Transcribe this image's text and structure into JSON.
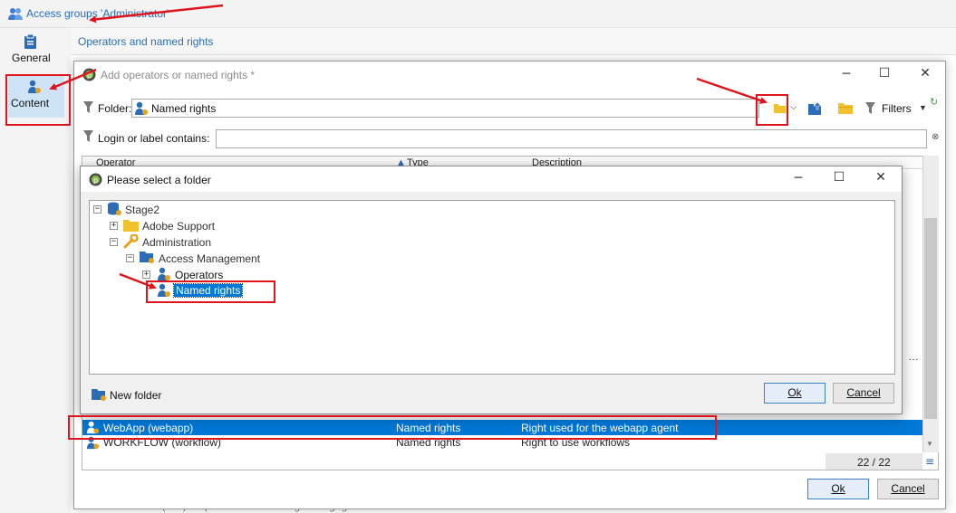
{
  "header": {
    "title": "Access groups 'Administrator'"
  },
  "left_rail": {
    "general_label": "General",
    "content_label": "Content"
  },
  "sub_header": {
    "title": "Operators and named rights"
  },
  "background_row_text": "Vallo Andusch (v3a) · Operator · Formal digital engagement · last date contract 15-10-19",
  "dialog1": {
    "title": "Add operators or named rights *",
    "folder_label": "Folder:",
    "folder_value": "Named rights",
    "login_label": "Login or label contains:",
    "login_value": "",
    "filters_label": "Filters",
    "columns": [
      "Operator",
      "Type",
      "Description"
    ],
    "rows": [
      {
        "operator": "WebApp (webapp)",
        "type": "Named rights",
        "description": "Right used for the webapp agent",
        "selected": true
      },
      {
        "operator": "WORKFLOW (workflow)",
        "type": "Named rights",
        "description": "Right to use workflows",
        "selected": false
      }
    ],
    "count": "22 / 22",
    "ok_label": "Ok",
    "cancel_label": "Cancel"
  },
  "dialog2": {
    "title": "Please select a folder",
    "tree": {
      "root": "Stage2",
      "adobe_support": "Adobe Support",
      "administration": "Administration",
      "access_management": "Access Management",
      "operators": "Operators",
      "named_rights": "Named rights"
    },
    "new_folder_label": "New folder",
    "ok_label": "Ok",
    "cancel_label": "Cancel"
  },
  "colors": {
    "accent_blue": "#2a6cb5",
    "selection_blue": "#0078d7",
    "annotation_red": "#e0141c",
    "folder_yellow": "#f2c12e"
  }
}
